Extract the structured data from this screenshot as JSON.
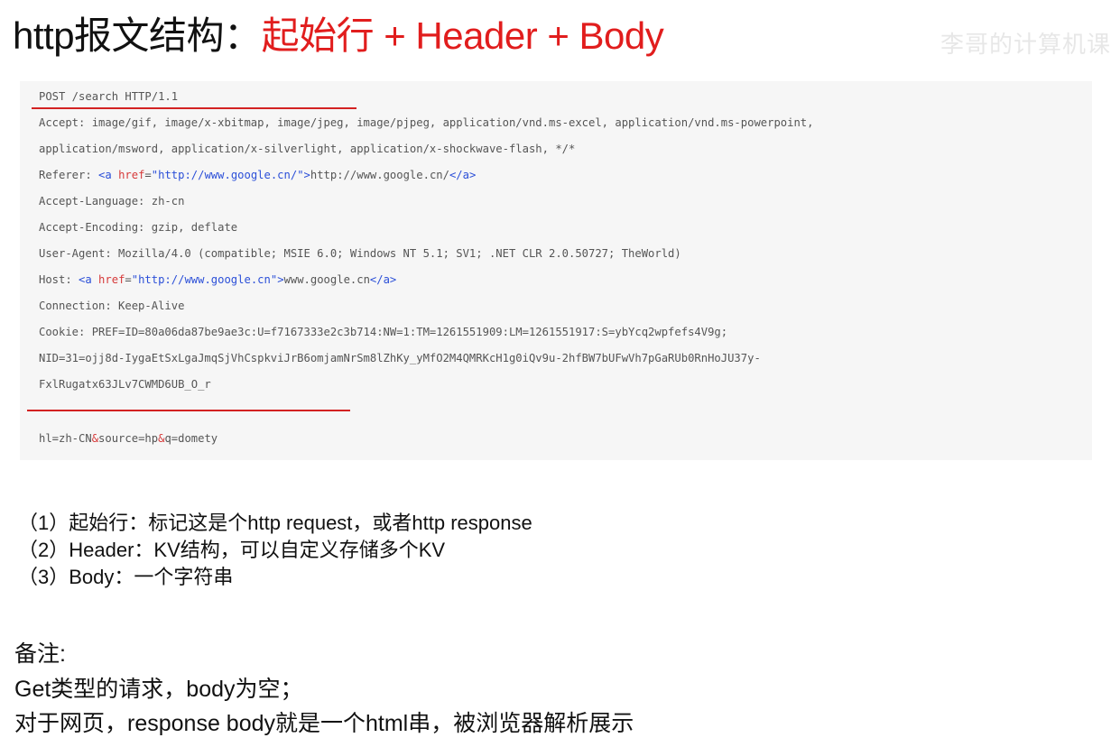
{
  "title": {
    "prefix": "http报文结构：",
    "highlight": "起始行 + Header + Body",
    "prefix_color": "#111111",
    "highlight_color": "#e11d1d"
  },
  "watermark": "李哥的计算机课",
  "code": {
    "start_line": "POST /search HTTP/1.1",
    "accept_1": "Accept: image/gif, image/x-xbitmap, image/jpeg, image/pjpeg, application/vnd.ms-excel, application/vnd.ms-powerpoint,",
    "accept_2": "application/msword, application/x-silverlight, application/x-shockwave-flash, */*",
    "referer": {
      "key": "Referer: ",
      "tag_open": "<a",
      "attr": " href",
      "eq": "=",
      "value": "\"http://www.google.cn/\"",
      "gt": ">",
      "text": "http://www.google.cn/",
      "tag_close": "</a>"
    },
    "accept_language": "Accept-Language: zh-cn",
    "accept_encoding": "Accept-Encoding: gzip, deflate",
    "user_agent": "User-Agent: Mozilla/4.0 (compatible; MSIE 6.0; Windows NT 5.1; SV1; .NET CLR 2.0.50727; TheWorld)",
    "host": {
      "key": "Host: ",
      "tag_open": "<a",
      "attr": " href",
      "eq": "=",
      "value": "\"http://www.google.cn\"",
      "gt": ">",
      "text": "www.google.cn",
      "tag_close": "</a>"
    },
    "connection": "Connection: Keep-Alive",
    "cookie_1": "Cookie: PREF=ID=80a06da87be9ae3c:U=f7167333e2c3b714:NW=1:TM=1261551909:LM=1261551917:S=ybYcq2wpfefs4V9g;",
    "cookie_2": "NID=31=ojj8d-IygaEtSxLgaJmqSjVhCspkviJrB6omjamNrSm8lZhKy_yMfO2M4QMRKcH1g0iQv9u-2hfBW7bUFwVh7pGaRUb0RnHoJU37y-",
    "cookie_3": "FxlRugatx63JLv7CWMD6UB_O_r",
    "body": {
      "part1": "hl=zh-CN",
      "amp1": "&",
      "part2": "source=hp",
      "amp2": "&",
      "part3": "q=domety"
    }
  },
  "notes": [
    "（1）起始行：标记这是个http request，或者http response",
    "（2）Header：KV结构，可以自定义存储多个KV",
    "（3）Body：一个字符串"
  ],
  "remark": {
    "heading": "备注:",
    "line1": "Get类型的请求，body为空；",
    "line2": "对于网页，response body就是一个html串，被浏览器解析展示"
  }
}
